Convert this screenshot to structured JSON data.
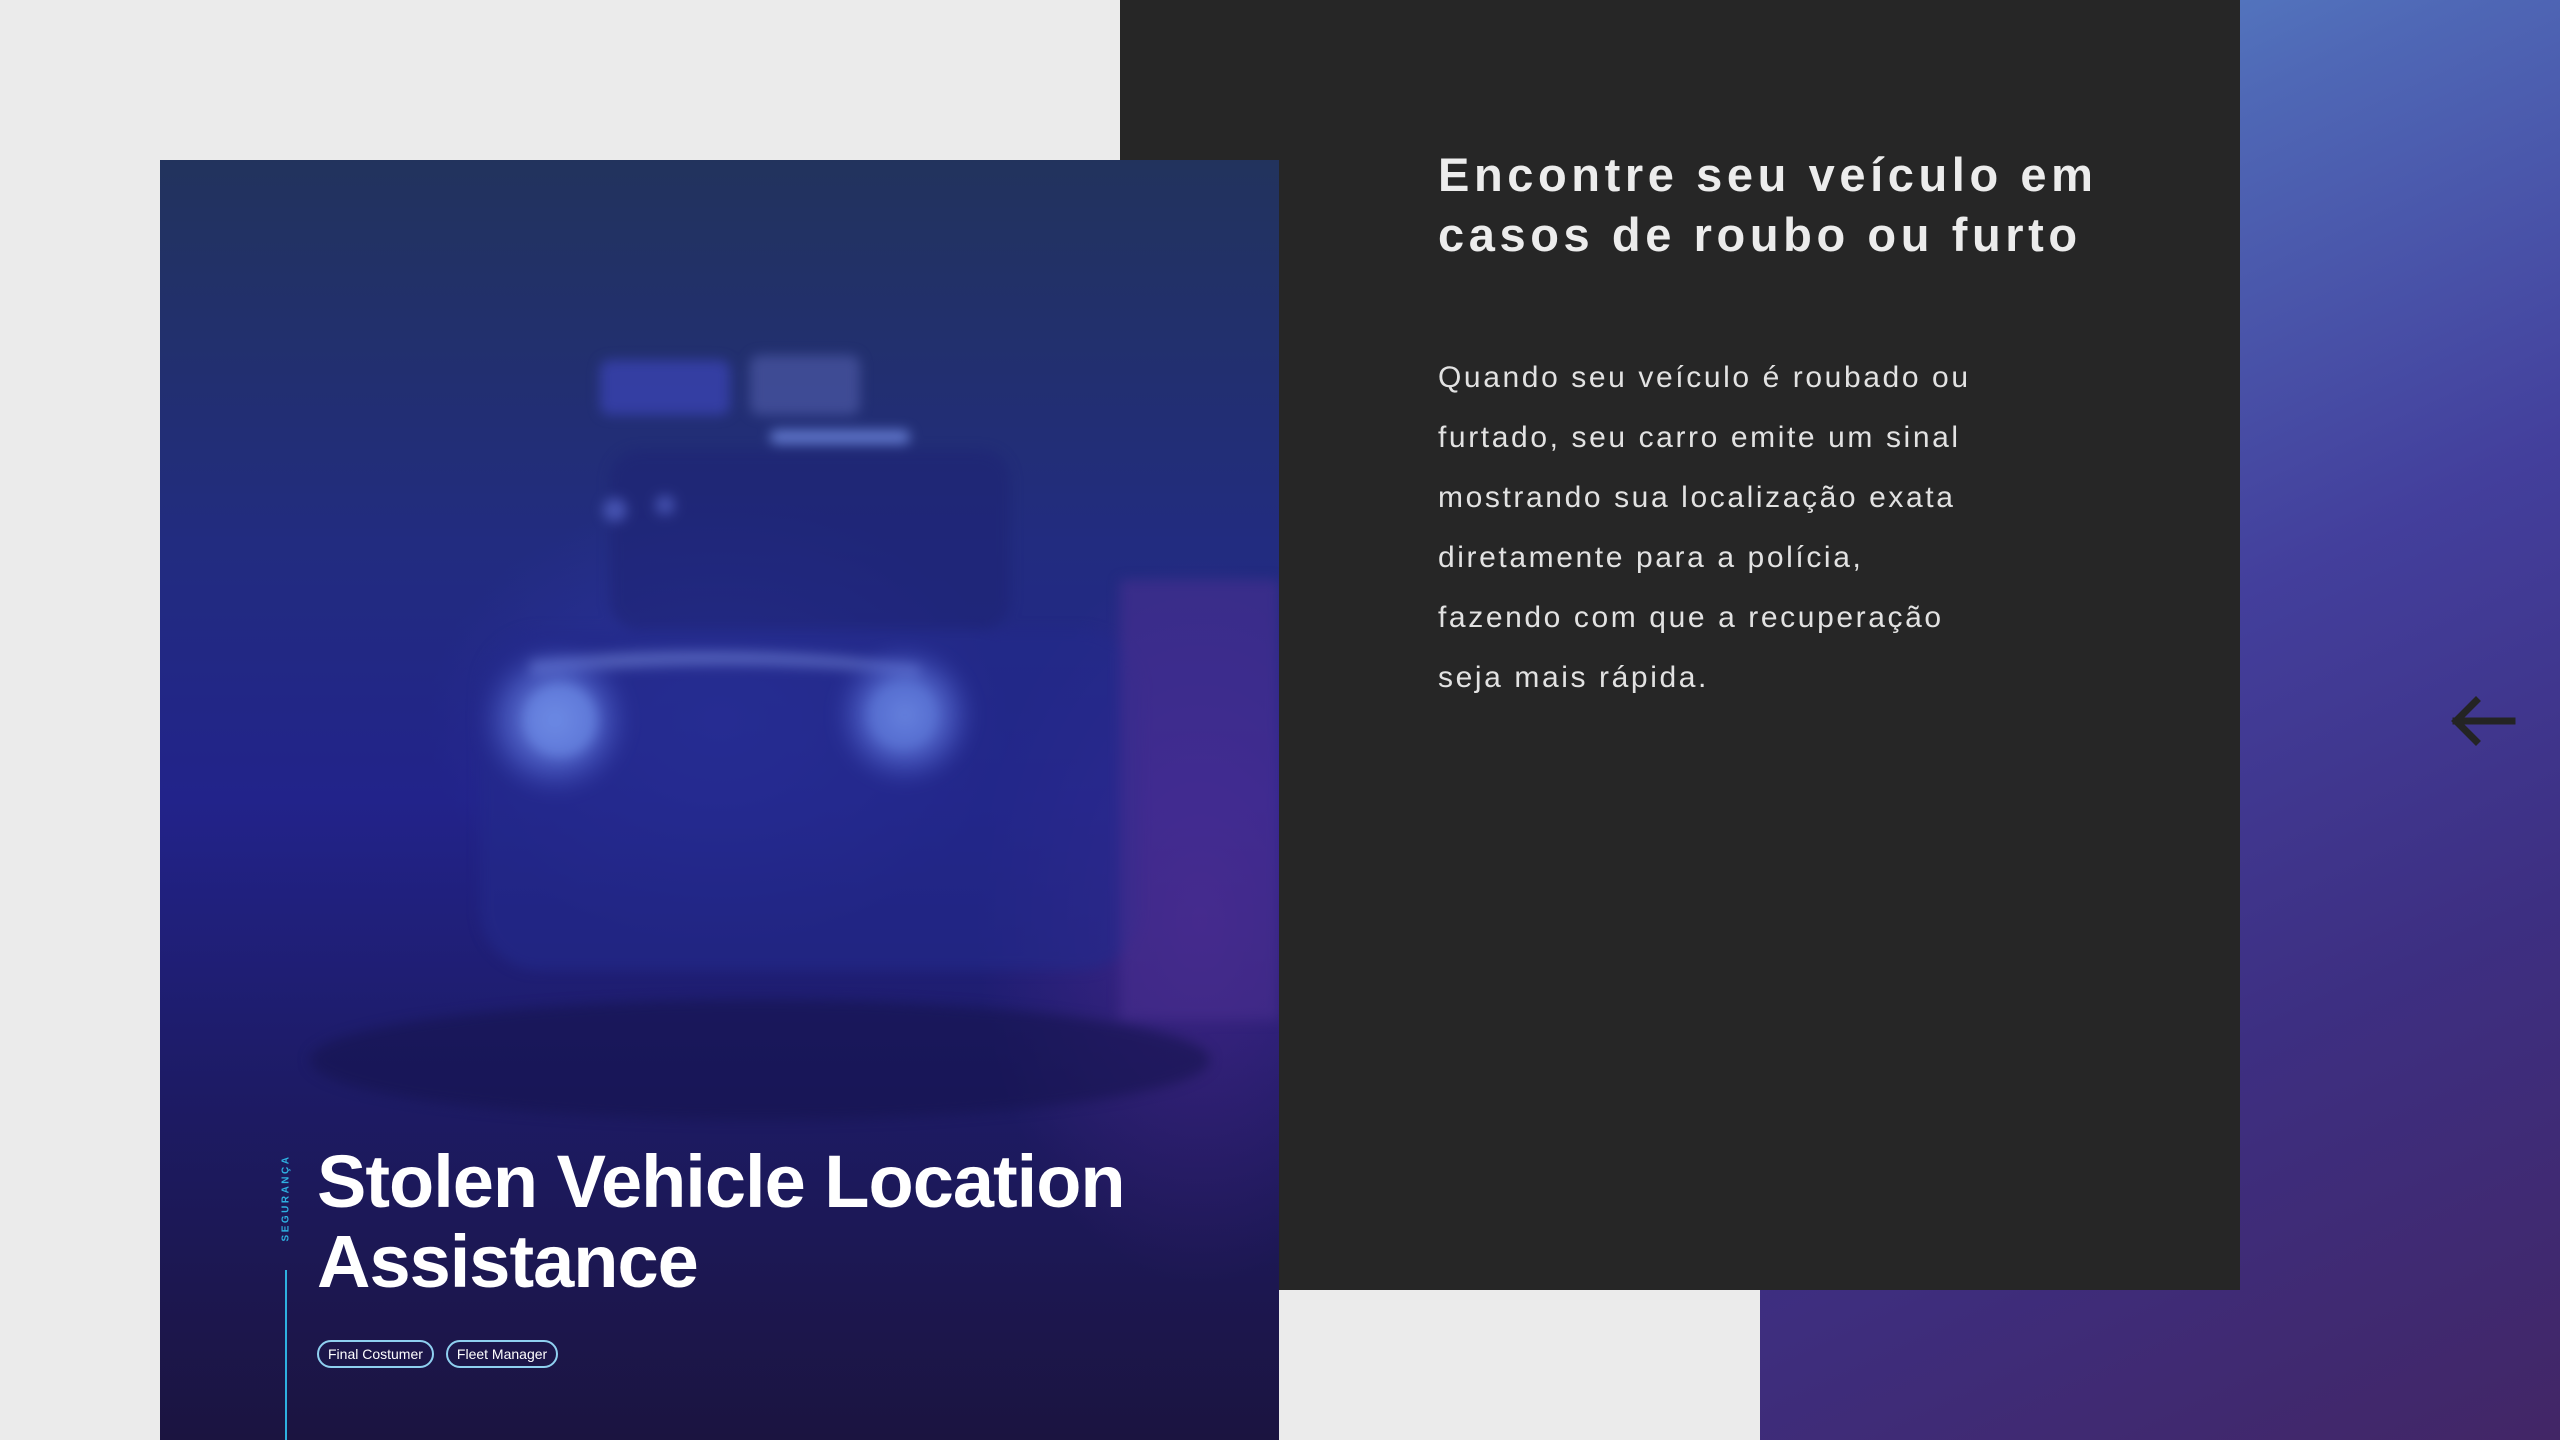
{
  "slide": {
    "heading": "Encontre seu veículo em casos de roubo ou furto",
    "body": "Quando seu veículo é roubado ou\nfurtado, seu carro emite um sinal\nmostrando sua localização exata\ndiretamente para a polícia,\nfazendo com que a recuperação\nseja mais rápida."
  },
  "card": {
    "category": "SEGURANÇA",
    "title": "Stolen Vehicle Location Assistance",
    "tags": [
      "Final Costumer",
      "Fleet Manager"
    ],
    "image_icon": "police-car-photo"
  },
  "nav": {
    "prev_icon": "arrow-left-icon"
  },
  "colors": {
    "accent": "#2eb0e0",
    "dark_panel": "#262626",
    "page_background": "#ebebeb",
    "gradient_top": "#5a8ccc",
    "gradient_bottom": "#422666"
  }
}
